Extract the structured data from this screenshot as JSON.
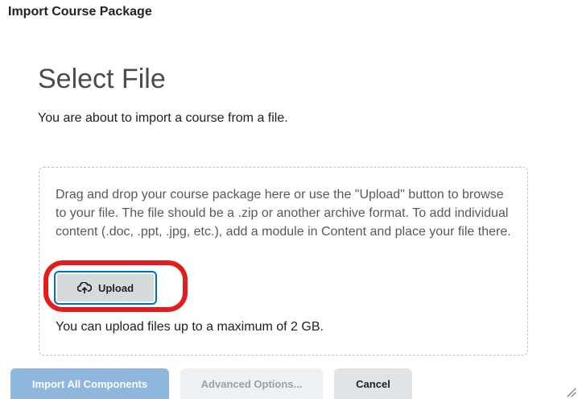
{
  "dialog": {
    "title": "Import Course Package"
  },
  "main": {
    "heading": "Select File",
    "intro": "You are about to import a course from a file."
  },
  "dropzone": {
    "instructions": "Drag and drop your course package here or use the \"Upload\" button to browse to your file. The file should be a .zip or another archive format. To add individual content (.doc, .ppt, .jpg, etc.), add a module in Content and place your file there.",
    "upload_label": "Upload",
    "upload_icon": "cloud-upload-icon",
    "max_size_text": "You can upload files up to a maximum of 2 GB."
  },
  "footer": {
    "import_label": "Import All Components",
    "advanced_label": "Advanced Options...",
    "cancel_label": "Cancel"
  },
  "colors": {
    "highlight": "#e31d1b",
    "focus_ring": "#006fbf",
    "primary_disabled": "#8fb6dd"
  }
}
